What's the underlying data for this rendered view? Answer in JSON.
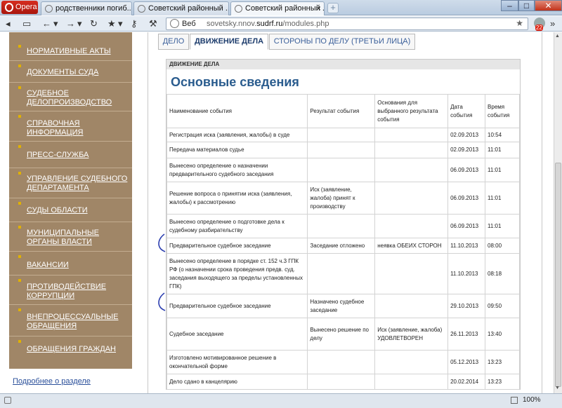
{
  "browser": {
    "menu_label": "Opera",
    "tabs": [
      {
        "title": "родственники погиб....."
      },
      {
        "title": "Советский районный ..."
      },
      {
        "title": "Советский районный ..."
      }
    ],
    "address": {
      "scheme_label": "Веб",
      "url_prefix": "sovetsky.nnov.",
      "url_host": "sudrf.ru",
      "url_path": "/modules.php"
    },
    "mail_count": "22",
    "zoom": "100%"
  },
  "sidebar": {
    "items": [
      {
        "label": "НОРМАТИВНЫЕ АКТЫ"
      },
      {
        "label": "ДОКУМЕНТЫ СУДА"
      },
      {
        "label": "СУДЕБНОЕ ДЕЛОПРОИЗВОДСТВО"
      },
      {
        "label": "СПРАВОЧНАЯ ИНФОРМАЦИЯ"
      },
      {
        "label": "ПРЕСС-СЛУЖБА"
      },
      {
        "label": "УПРАВЛЕНИЕ СУДЕБНОГО ДЕПАРТАМЕНТА"
      },
      {
        "label": "СУДЫ ОБЛАСТИ"
      },
      {
        "label": "МУНИЦИПАЛЬНЫЕ ОРГАНЫ ВЛАСТИ"
      },
      {
        "label": "ВАКАНСИИ"
      },
      {
        "label": "ПРОТИВОДЕЙСТВИЕ КОРРУПЦИИ"
      },
      {
        "label": "ВНЕПРОЦЕССУАЛЬНЫЕ ОБРАЩЕНИЯ"
      },
      {
        "label": "ОБРАЩЕНИЯ ГРАЖДАН"
      }
    ],
    "more_link": "Подробнее о разделе"
  },
  "case_tabs": [
    {
      "label": "ДЕЛО"
    },
    {
      "label": "ДВИЖЕНИЕ ДЕЛА"
    },
    {
      "label": "СТОРОНЫ ПО ДЕЛУ (ТРЕТЬИ ЛИЦА)"
    }
  ],
  "panel": {
    "header": "ДВИЖЕНИЕ ДЕЛА",
    "title": "Основные сведения",
    "columns": [
      "Наименование события",
      "Результат события",
      "Основания для выбранного результата события",
      "Дата события",
      "Время события"
    ],
    "rows": [
      [
        "Регистрация иска (заявления, жалобы) в суде",
        "",
        "",
        "02.09.2013",
        "10:54"
      ],
      [
        "Передача материалов судье",
        "",
        "",
        "02.09.2013",
        "11:01"
      ],
      [
        "Вынесено определение о назначении предварительного судебного заседания",
        "",
        "",
        "06.09.2013",
        "11:01"
      ],
      [
        "Решение вопроса о принятии иска (заявления, жалобы) к рассмотрению",
        "Иск (заявление, жалоба) принят к производству",
        "",
        "06.09.2013",
        "11:01"
      ],
      [
        "Вынесено определение о подготовке дела к судебному разбирательству",
        "",
        "",
        "06.09.2013",
        "11:01"
      ],
      [
        "Предварительное судебное заседание",
        "Заседание отложено",
        "неявка ОБЕИХ СТОРОН",
        "11.10.2013",
        "08:00"
      ],
      [
        "Вынесено определение в порядке ст. 152 ч.3 ГПК РФ (о назначении срока проведения предв. суд. заседания выходящего за пределы установленных ГПК)",
        "",
        "",
        "11.10.2013",
        "08:18"
      ],
      [
        "Предварительное судебное заседание",
        "Назначено судебное заседание",
        "",
        "29.10.2013",
        "09:50"
      ],
      [
        "Судебное заседание",
        "Вынесено решение по делу",
        "Иск (заявление, жалоба) УДОВЛЕТВОРЕН",
        "26.11.2013",
        "13:40"
      ],
      [
        "Изготовлено мотивированное решение в окончательной форме",
        "",
        "",
        "05.12.2013",
        "13:23"
      ],
      [
        "Дело сдано в канцелярию",
        "",
        "",
        "20.02.2014",
        "13:23"
      ]
    ]
  }
}
